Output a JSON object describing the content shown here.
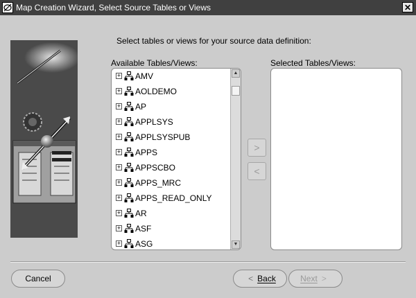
{
  "window": {
    "title": "Map Creation Wizard, Select Source Tables or Views",
    "close_label": "✕"
  },
  "instruction": "Select tables or views for your source data definition:",
  "available": {
    "label": "Available Tables/Views:",
    "items": [
      "AMV",
      "AOLDEMO",
      "AP",
      "APPLSYS",
      "APPLSYSPUB",
      "APPS",
      "APPSCBO",
      "APPS_MRC",
      "APPS_READ_ONLY",
      "AR",
      "ASF",
      "ASG"
    ],
    "scroll_position": 0.05
  },
  "selected": {
    "label": "Selected Tables/Views:",
    "items": []
  },
  "move_buttons": {
    "add_icon": "chevron-right-icon",
    "remove_icon": "chevron-left-icon",
    "enabled": false
  },
  "buttons": {
    "cancel": "Cancel",
    "back": "Back",
    "next": "Next",
    "next_enabled": false
  }
}
